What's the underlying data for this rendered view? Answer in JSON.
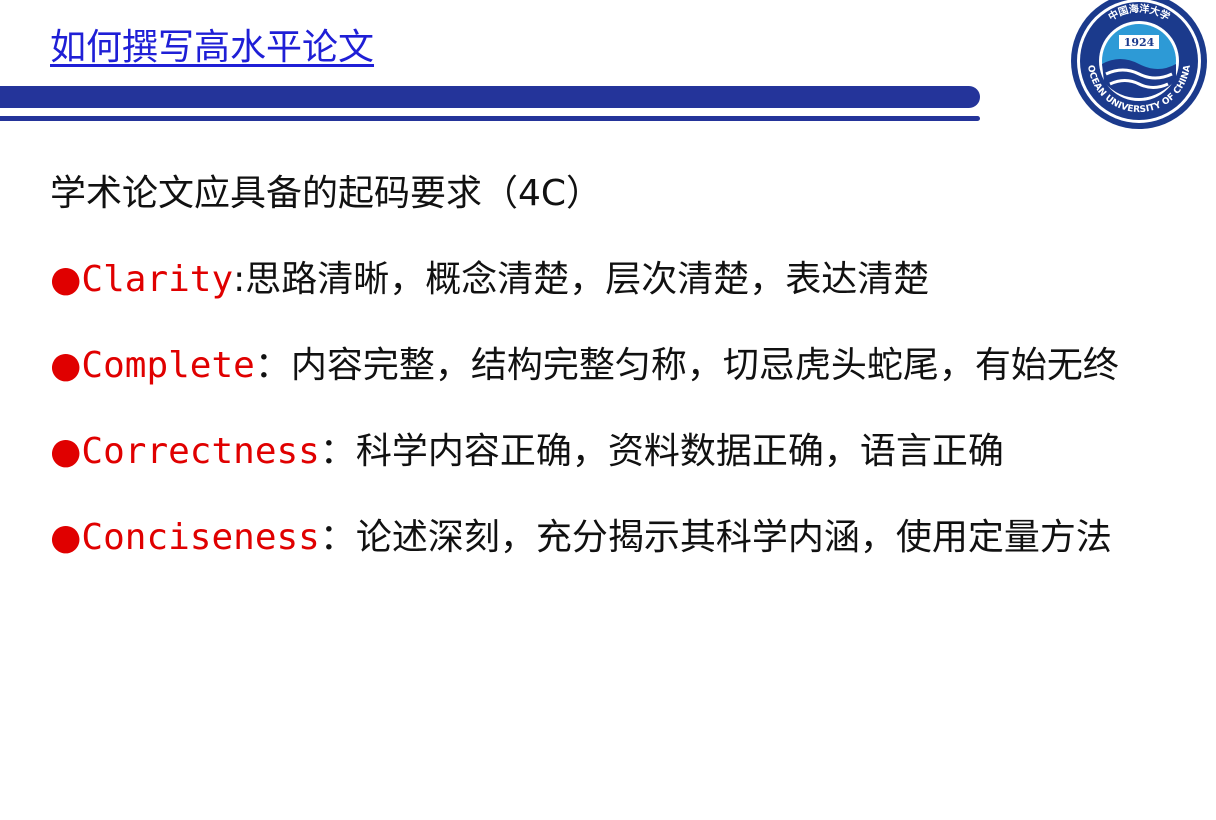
{
  "slide": {
    "title": "如何撰写高水平论文",
    "heading": "学术论文应具备的起码要求（4C）",
    "items": [
      {
        "bullet": "●",
        "term": "Clarity",
        "sep": ":",
        "text": "思路清晰，概念清楚，层次清楚，表达清楚"
      },
      {
        "bullet": "●",
        "term": "Complete",
        "sep": "：",
        "text": "内容完整，结构完整匀称，切忌虎头蛇尾，有始无终"
      },
      {
        "bullet": "●",
        "term": "Correctness",
        "sep": "：",
        "text": "科学内容正确，资料数据正确，语言正确"
      },
      {
        "bullet": "●",
        "term": "Conciseness",
        "sep": "：",
        "text": "论述深刻，充分揭示其科学内涵，使用定量方法"
      }
    ]
  },
  "logo": {
    "year": "1924",
    "name_en": "OCEAN UNIVERSITY OF CHINA",
    "name_cn": "中国海洋大学"
  },
  "colors": {
    "title": "#1f1fd6",
    "bar": "#24349a",
    "accent": "#e00000",
    "text": "#111111"
  }
}
